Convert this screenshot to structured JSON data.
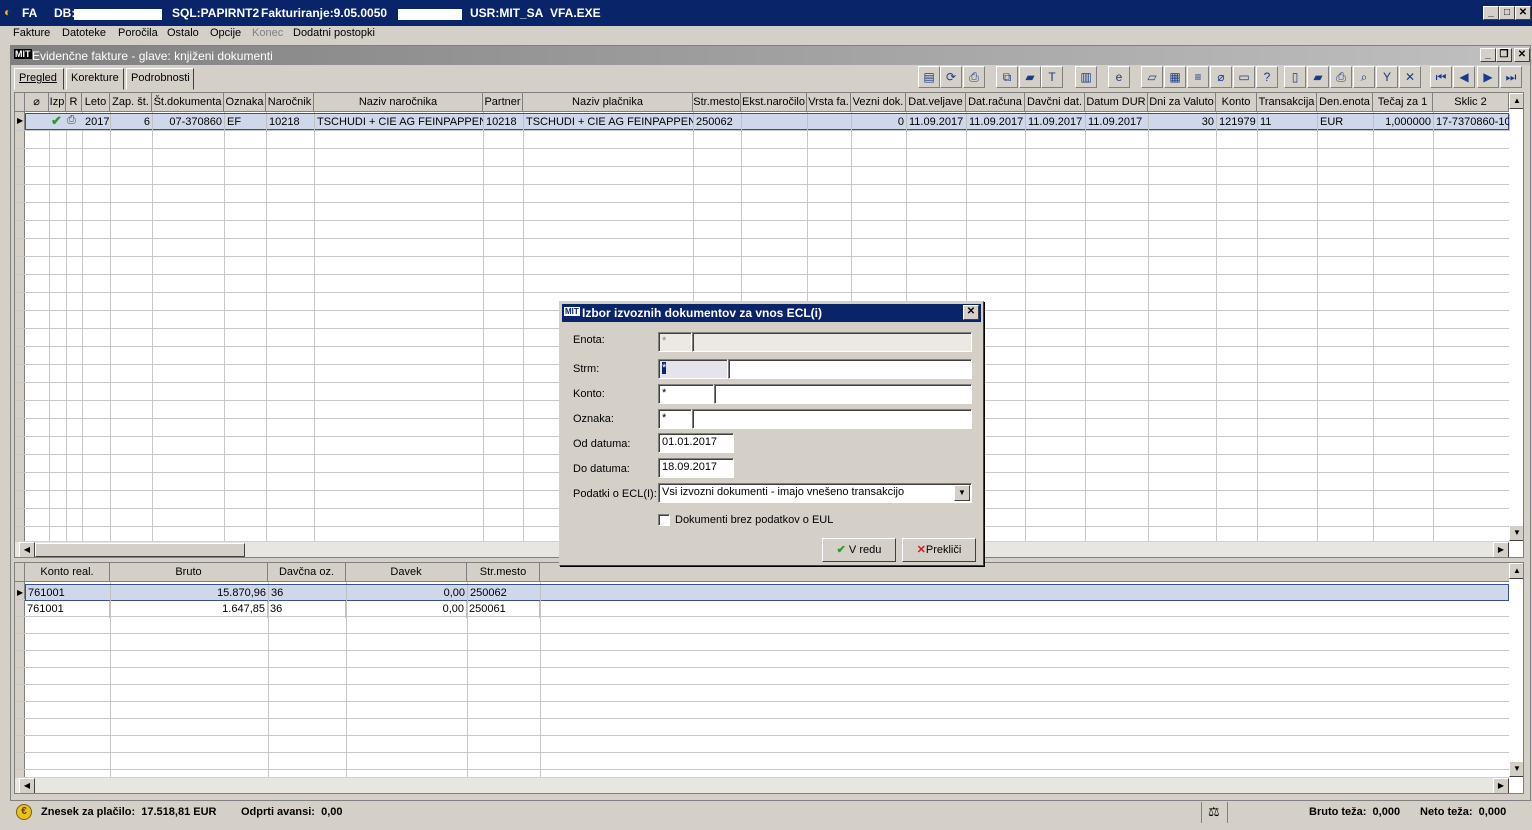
{
  "titlebar": {
    "app": "FA",
    "db_label": "DB:",
    "sql": "SQL:PAPIRNT2",
    "fakturiranje": "Fakturiranje:9.05.0050",
    "user": "USR:MIT_SA",
    "exe": "VFA.EXE"
  },
  "menu": [
    "Fakture",
    "Datoteke",
    "Poročila",
    "Ostalo",
    "Opcije",
    "Konec",
    "Dodatni postopki"
  ],
  "child_window": {
    "title": "Evidenčne fakture - glave: knjiženi dokumenti"
  },
  "tabs": [
    "Pregled",
    "Korekture",
    "Podrobnosti"
  ],
  "main_grid": {
    "columns": [
      "Izp",
      "R",
      "Leto",
      "Zap. št.",
      "Št.dokumenta",
      "Oznaka",
      "Naročnik",
      "Naziv naročnika",
      "Partner",
      "Naziv plačnika",
      "Str.mesto",
      "Ekst.naročilo",
      "Vrsta fa.",
      "Vezni dok.",
      "Dat.veljave",
      "Dat.računa",
      "Davčni dat.",
      "Datum DUR",
      "Dni za Valuto",
      "Konto",
      "Transakcija",
      "Den.enota",
      "Tečaj za 1",
      "Sklic 2"
    ],
    "rows": [
      [
        "",
        "",
        "2017",
        "6",
        "07-370860",
        "EF",
        "10218",
        "TSCHUDI + CIE AG FEINPAPPEN",
        "10218",
        "TSCHUDI + CIE AG FEINPAPPEN",
        "250062",
        "",
        "",
        "0",
        "11.09.2017",
        "11.09.2017",
        "11.09.2017",
        "11.09.2017",
        "30",
        "121979",
        "11",
        "EUR",
        "1,000000",
        "17-7370860-10"
      ]
    ]
  },
  "detail_grid": {
    "columns": [
      "Konto real.",
      "Bruto",
      "Davčna oz.",
      "Davek",
      "Str.mesto"
    ],
    "rows": [
      [
        "761001",
        "15.870,96",
        "36",
        "0,00",
        "250062"
      ],
      [
        "761001",
        "1.647,85",
        "36",
        "0,00",
        "250061"
      ]
    ]
  },
  "dialog": {
    "title": "Izbor izvoznih dokumentov za vnos ECL(i)",
    "enota_label": "Enota:",
    "enota_value": "*",
    "strm_label": "Strm:",
    "strm_value": "*",
    "konto_label": "Konto:",
    "konto_value": "*",
    "oznaka_label": "Oznaka:",
    "oznaka_value": "*",
    "od_label": "Od datuma:",
    "od_value": "01.01.2017",
    "do_label": "Do datuma:",
    "do_value": "18.09.2017",
    "podatki_label": "Podatki o ECL(I):",
    "podatki_value": "Vsi izvozni dokumenti - imajo vnešeno transakcijo",
    "checkbox_label": "Dokumenti brez podatkov o EUL",
    "ok_label": "V redu",
    "cancel_label": "Prekliči"
  },
  "statusbar": {
    "znesek": "Znesek za plačilo:  17.518,81 EUR",
    "avansi": "Odprti avansi:  0,00",
    "bruto": "Bruto teža:  0,000",
    "neto": "Neto teža:  0,000"
  },
  "colors": {
    "title_blue": "#0a246a",
    "selection": "#cfd8ea",
    "face": "#d4d0c8"
  }
}
